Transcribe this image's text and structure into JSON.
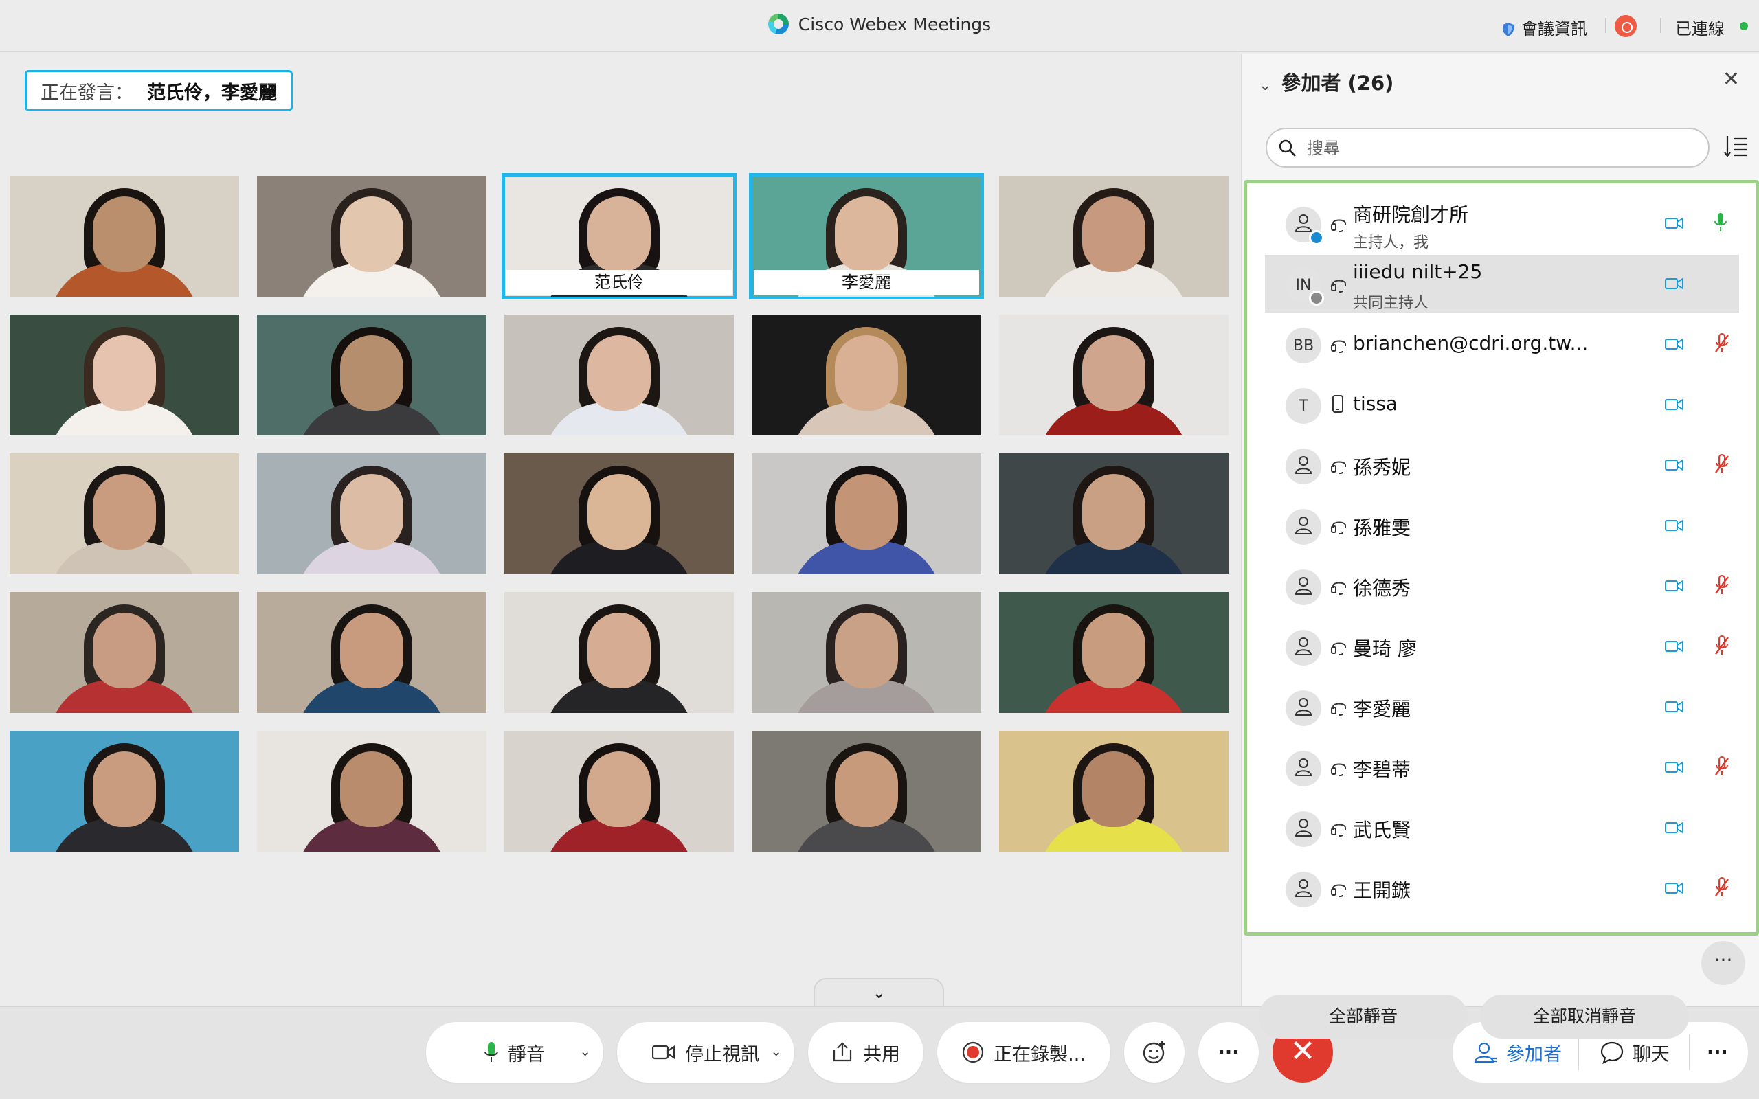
{
  "window": {
    "title": "Cisco Webex Meetings",
    "meeting_info_label": "會議資訊",
    "connection_status": "已連線"
  },
  "stage": {
    "speaking_label": "正在發言：",
    "speaking_names": "范氏伶，李愛麗",
    "tiles": [
      {
        "name": "",
        "bg": "#d8d2c6",
        "skin": "#b98f6e",
        "hair": "#1a1410",
        "cloth": "#b4582b",
        "active": false
      },
      {
        "name": "",
        "bg": "#8b8178",
        "skin": "#e2c6ae",
        "hair": "#2a211d",
        "cloth": "#f4f1ec",
        "active": false
      },
      {
        "name": "范氏伶",
        "bg": "#e9e6e2",
        "skin": "#d8b39a",
        "hair": "#181312",
        "cloth": "#2b2b2b",
        "active": true
      },
      {
        "name": "李愛麗",
        "bg": "#5aa596",
        "skin": "#dcb79b",
        "hair": "#2a221d",
        "cloth": "#e8e5e1",
        "active": true
      },
      {
        "name": "",
        "bg": "#cfc8bd",
        "skin": "#c79a80",
        "hair": "#241b16",
        "cloth": "#eeebe6",
        "active": false
      },
      {
        "name": "",
        "bg": "#3a4d41",
        "skin": "#e5c3ae",
        "hair": "#3b2a20",
        "cloth": "#f4f1ed",
        "active": false
      },
      {
        "name": "",
        "bg": "#4f6e67",
        "skin": "#b58e6e",
        "hair": "#15100d",
        "cloth": "#3b3b3d",
        "active": false
      },
      {
        "name": "",
        "bg": "#c6c2bb",
        "skin": "#ddb79f",
        "hair": "#1d1714",
        "cloth": "#e6e8ef",
        "active": false
      },
      {
        "name": "",
        "bg": "#1a1a1a",
        "skin": "#d9b094",
        "hair": "#b58a5a",
        "cloth": "#d8c6b8",
        "active": false
      },
      {
        "name": "",
        "bg": "#e7e5e3",
        "skin": "#cfa58d",
        "hair": "#1b1513",
        "cloth": "#9b1e1a",
        "active": false
      },
      {
        "name": "",
        "bg": "#dad1c1",
        "skin": "#c99c7f",
        "hair": "#1b1714",
        "cloth": "#cfc3b6",
        "active": false
      },
      {
        "name": "",
        "bg": "#a7b0b4",
        "skin": "#ddbca6",
        "hair": "#2a2220",
        "cloth": "#dcd4e0",
        "active": false
      },
      {
        "name": "",
        "bg": "#6a5a4c",
        "skin": "#dab596",
        "hair": "#17120f",
        "cloth": "#1e1e22",
        "active": false
      },
      {
        "name": "",
        "bg": "#c9c8c7",
        "skin": "#c39475",
        "hair": "#151110",
        "cloth": "#4055a7",
        "active": false
      },
      {
        "name": "",
        "bg": "#3f4749",
        "skin": "#caa085",
        "hair": "#1d1612",
        "cloth": "#1f3049",
        "active": false
      },
      {
        "name": "",
        "bg": "#b6aa9b",
        "skin": "#c79c82",
        "hair": "#2c2623",
        "cloth": "#b53132",
        "active": false
      },
      {
        "name": "",
        "bg": "#b8ab9b",
        "skin": "#c89a7e",
        "hair": "#181412",
        "cloth": "#20466b",
        "active": false
      },
      {
        "name": "",
        "bg": "#e0ddd9",
        "skin": "#d6ad92",
        "hair": "#1a1512",
        "cloth": "#252427",
        "active": false
      },
      {
        "name": "",
        "bg": "#b9b7b2",
        "skin": "#c9a186",
        "hair": "#2a2220",
        "cloth": "#a59c9c",
        "active": false
      },
      {
        "name": "",
        "bg": "#3f5a4d",
        "skin": "#c79c7f",
        "hair": "#1a1411",
        "cloth": "#c8312d",
        "active": false
      },
      {
        "name": "",
        "bg": "#4aa1c6",
        "skin": "#c99c7f",
        "hair": "#1c1714",
        "cloth": "#2a2a2e",
        "active": false
      },
      {
        "name": "",
        "bg": "#e8e4df",
        "skin": "#b98c6e",
        "hair": "#19130f",
        "cloth": "#5d2c3e",
        "active": false
      },
      {
        "name": "",
        "bg": "#d8d3cd",
        "skin": "#d2a98d",
        "hair": "#16110f",
        "cloth": "#9e2227",
        "active": false
      },
      {
        "name": "",
        "bg": "#7d7a73",
        "skin": "#c79a7c",
        "hair": "#1b1512",
        "cloth": "#4a4a4c",
        "active": false
      },
      {
        "name": "",
        "bg": "#d9c28b",
        "skin": "#b48467",
        "hair": "#1c1512",
        "cloth": "#e6e04a",
        "active": false
      }
    ]
  },
  "toolbar": {
    "mute_label": "靜音",
    "stop_video_label": "停止視訊",
    "share_label": "共用",
    "recording_label": "正在錄製...",
    "more_label": "···",
    "end_label": "✕",
    "participants_label": "參加者",
    "chat_label": "聊天",
    "right_more_label": "···"
  },
  "panel": {
    "title": "參加者 (26)",
    "search_placeholder": "搜尋",
    "participants": [
      {
        "name": "商研院創才所",
        "role": "主持人，我",
        "initials": "",
        "device": "headset",
        "mic": "on",
        "selected": false,
        "badge": "#1a8bd1"
      },
      {
        "name": "iiiedu nilt+25",
        "role": "共同主持人",
        "initials": "IN",
        "device": "headset",
        "mic": "none",
        "selected": true,
        "badge": "#888888"
      },
      {
        "name": "brianchen@cdri.org.tw...",
        "role": "",
        "initials": "BB",
        "device": "headset",
        "mic": "muted",
        "selected": false,
        "badge": ""
      },
      {
        "name": "tissa",
        "role": "",
        "initials": "T",
        "device": "phone",
        "mic": "none",
        "selected": false,
        "badge": ""
      },
      {
        "name": "孫秀妮",
        "role": "",
        "initials": "",
        "device": "headset",
        "mic": "muted",
        "selected": false,
        "badge": ""
      },
      {
        "name": "孫雅雯",
        "role": "",
        "initials": "",
        "device": "headset",
        "mic": "none",
        "selected": false,
        "badge": ""
      },
      {
        "name": "徐德秀",
        "role": "",
        "initials": "",
        "device": "headset",
        "mic": "muted",
        "selected": false,
        "badge": ""
      },
      {
        "name": "曼琦 廖",
        "role": "",
        "initials": "",
        "device": "headset",
        "mic": "muted",
        "selected": false,
        "badge": ""
      },
      {
        "name": "李愛麗",
        "role": "",
        "initials": "",
        "device": "headset",
        "mic": "none",
        "selected": false,
        "badge": ""
      },
      {
        "name": "李碧蒂",
        "role": "",
        "initials": "",
        "device": "headset",
        "mic": "muted",
        "selected": false,
        "badge": ""
      },
      {
        "name": "武氏賢",
        "role": "",
        "initials": "",
        "device": "headset",
        "mic": "none",
        "selected": false,
        "badge": ""
      },
      {
        "name": "王開鏃",
        "role": "",
        "initials": "",
        "device": "headset",
        "mic": "muted",
        "selected": false,
        "badge": ""
      }
    ],
    "mute_all_label": "全部靜音",
    "unmute_all_label": "全部取消靜音",
    "more_label": "···"
  },
  "colors": {
    "accent": "#16b4e8",
    "end_red": "#e0392d",
    "recording_red": "#ef5a45",
    "connected_green": "#2cb34a",
    "highlight_green": "#9ed08a"
  }
}
